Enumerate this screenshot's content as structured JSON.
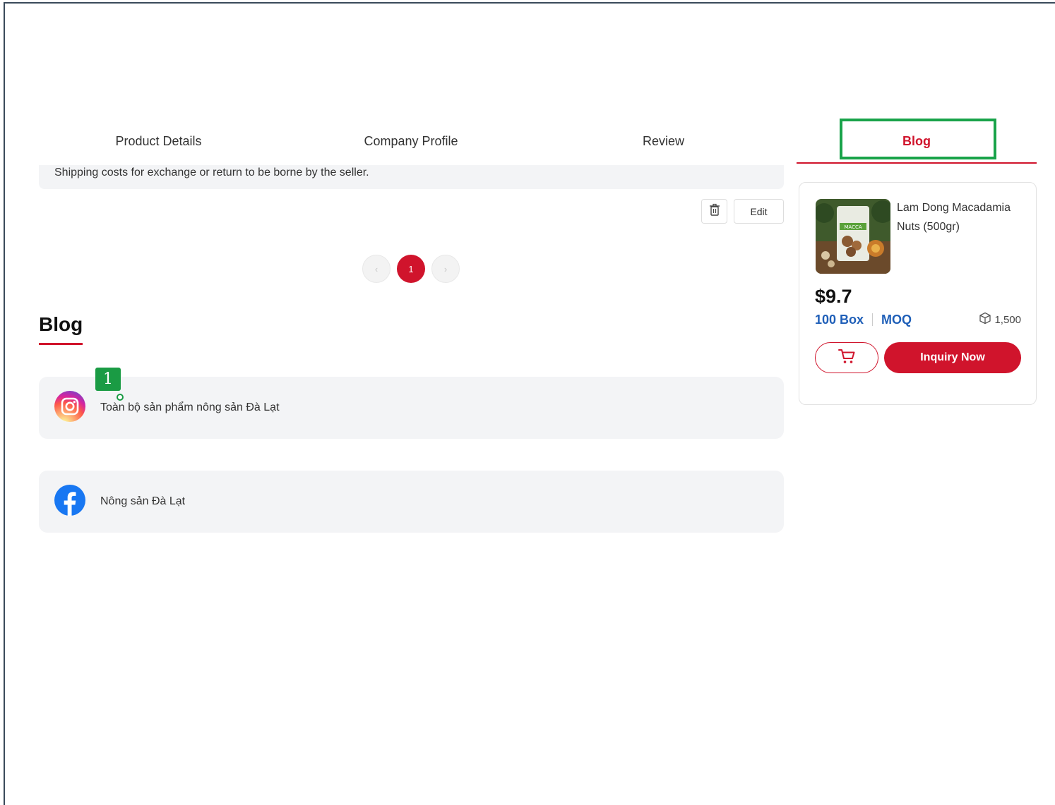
{
  "tabs": [
    {
      "label": "Product Details"
    },
    {
      "label": "Company Profile"
    },
    {
      "label": "Review"
    },
    {
      "label": "Blog",
      "active": true
    }
  ],
  "shipping_note": "Shipping costs for exchange or return to be borne by the seller.",
  "actions": {
    "edit_label": "Edit",
    "delete_icon": "trash-icon"
  },
  "pagination": {
    "current_page": "1",
    "prev_icon": "chevron-left-icon",
    "next_icon": "chevron-right-icon"
  },
  "blog": {
    "title": "Blog",
    "items": [
      {
        "icon": "instagram-icon",
        "label": "Toàn bộ sản phẩm nông sản Đà Lạt"
      },
      {
        "icon": "facebook-icon",
        "label": "Nông sản Đà Lạt"
      }
    ]
  },
  "annotation_marker": "1",
  "product": {
    "name": "Lam Dong Macadamia Nuts (500gr)",
    "price": "$9.7",
    "moq_qty": "100 Box",
    "moq_label": "MOQ",
    "stock": "1,500",
    "inquiry_label": "Inquiry Now",
    "cart_icon": "cart-icon",
    "stock_icon": "box-icon"
  },
  "colors": {
    "brand": "#d0142c",
    "link_blue": "#1f5fb8",
    "highlight": "#19a34a",
    "card_bg": "#f3f4f6"
  }
}
